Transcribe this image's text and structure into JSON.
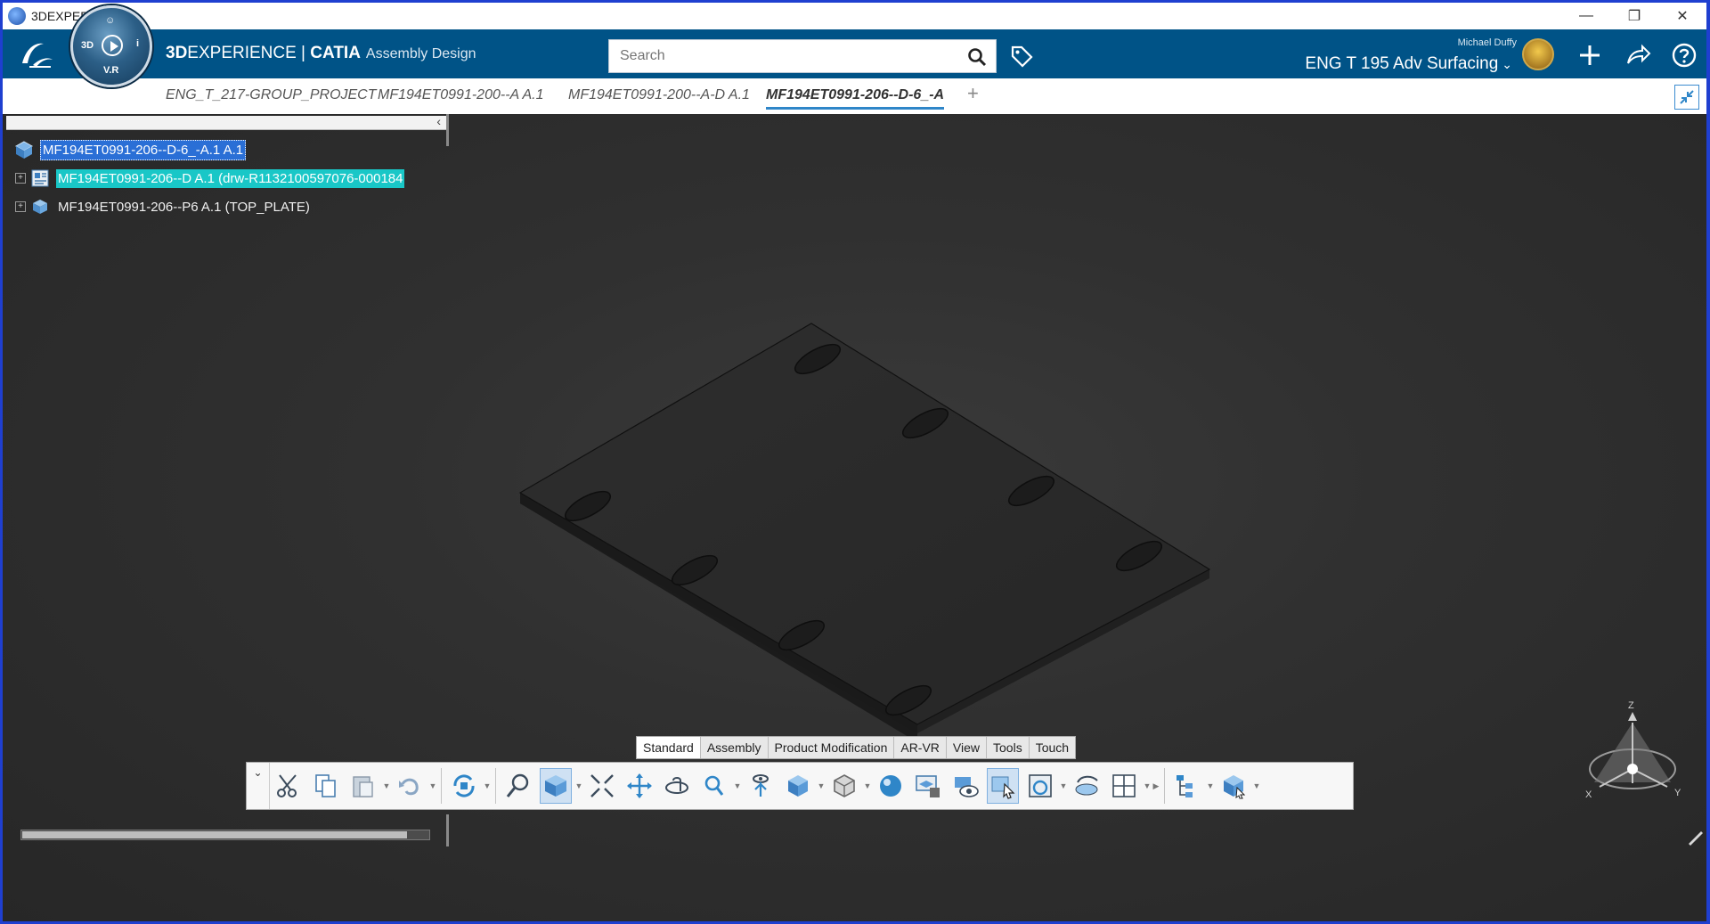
{
  "window": {
    "title": "3DEXPERIENCE",
    "controls": [
      "—",
      "❐",
      "✕"
    ]
  },
  "topbar": {
    "brand_bold": "3D",
    "brand_rest": "EXPERIENCE | ",
    "brand_catia": "CATIA",
    "app_name": "Assembly Design",
    "compass": {
      "top": "☺",
      "left": "3D",
      "right": "i",
      "bottom": "V.R"
    },
    "search_placeholder": "Search",
    "user_name": "Michael Duffy",
    "collab_space": "ENG T 195 Adv Surfacing",
    "icons": [
      "tag-icon",
      "add-icon",
      "share-icon",
      "help-icon"
    ]
  },
  "tabs": [
    {
      "label": "ENG_T_217-GROUP_PROJECT",
      "active": false
    },
    {
      "label": "MF194ET0991-200--A A.1",
      "active": false
    },
    {
      "label": "MF194ET0991-200--A-D A.1",
      "active": false
    },
    {
      "label": "MF194ET0991-206--D-6_-A",
      "active": true
    }
  ],
  "tab_add": "+",
  "tree": {
    "root": {
      "label": "MF194ET0991-206--D-6_-A.1 A.1"
    },
    "children": [
      {
        "label": "MF194ET0991-206--D A.1 (drw-R1132100597076-000184",
        "selected": true
      },
      {
        "label": "MF194ET0991-206--P6 A.1 (TOP_PLATE)",
        "selected": false
      }
    ]
  },
  "triad": {
    "z": "Z",
    "x": "X",
    "y": "Y"
  },
  "sections": [
    {
      "label": "Standard",
      "active": true
    },
    {
      "label": "Assembly",
      "active": false
    },
    {
      "label": "Product Modification",
      "active": false
    },
    {
      "label": "AR-VR",
      "active": false
    },
    {
      "label": "View",
      "active": false
    },
    {
      "label": "Tools",
      "active": false
    },
    {
      "label": "Touch",
      "active": false
    }
  ],
  "toolbar_icons": [
    "cut-icon",
    "copy-icon",
    "paste-icon",
    "undo-icon",
    "update-icon",
    "zoom-icon",
    "view-mode-icon",
    "fit-all-icon",
    "pan-icon",
    "rotate-icon",
    "zoom-in-icon",
    "fly-icon",
    "iso-view-icon",
    "render-style-icon",
    "ambience-icon",
    "capture-icon",
    "hide-show-icon",
    "select-icon",
    "reframe-icon",
    "measure-icon",
    "layout-icon",
    "tree-icon",
    "part-icon"
  ],
  "colors": {
    "topbar": "#005387",
    "selection_root": "#2a6fd6",
    "selection_child": "#19c7c7",
    "accent_tab": "#2f86c8"
  }
}
